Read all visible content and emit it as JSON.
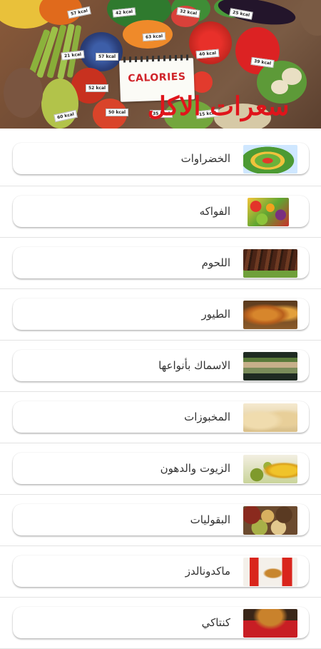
{
  "header": {
    "title": "سعرات الاكل",
    "note_text": "CALORIES",
    "kcal_labels": [
      "57 kcal",
      "42 kcal",
      "32 kcal",
      "25 kcal",
      "21 kcal",
      "57 kcal",
      "63 kcal",
      "40 kcal",
      "39 kcal",
      "52 kcal",
      "50 kcal",
      "60 kcal",
      "35 kcal",
      "15 kcal"
    ]
  },
  "categories": [
    {
      "label": "الخضراوات",
      "image": "vegetables-salad-thumbnail"
    },
    {
      "label": "الفواكه",
      "image": "fruits-thumbnail"
    },
    {
      "label": "اللحوم",
      "image": "grilled-meat-thumbnail"
    },
    {
      "label": "الطيور",
      "image": "roast-chicken-thumbnail"
    },
    {
      "label": "الاسماك بأنواعها",
      "image": "fish-thumbnail"
    },
    {
      "label": "المخبوزات",
      "image": "bread-thumbnail"
    },
    {
      "label": "الزيوت والدهون",
      "image": "olive-oil-thumbnail"
    },
    {
      "label": "البقوليات",
      "image": "legumes-thumbnail"
    },
    {
      "label": "ماكدونالدز",
      "image": "mcdonalds-meal-thumbnail"
    },
    {
      "label": "كنتاكي",
      "image": "kfc-bucket-thumbnail"
    }
  ],
  "colors": {
    "title_red": "#e0141b",
    "card_background": "#ffffff",
    "label_text": "#333333"
  }
}
